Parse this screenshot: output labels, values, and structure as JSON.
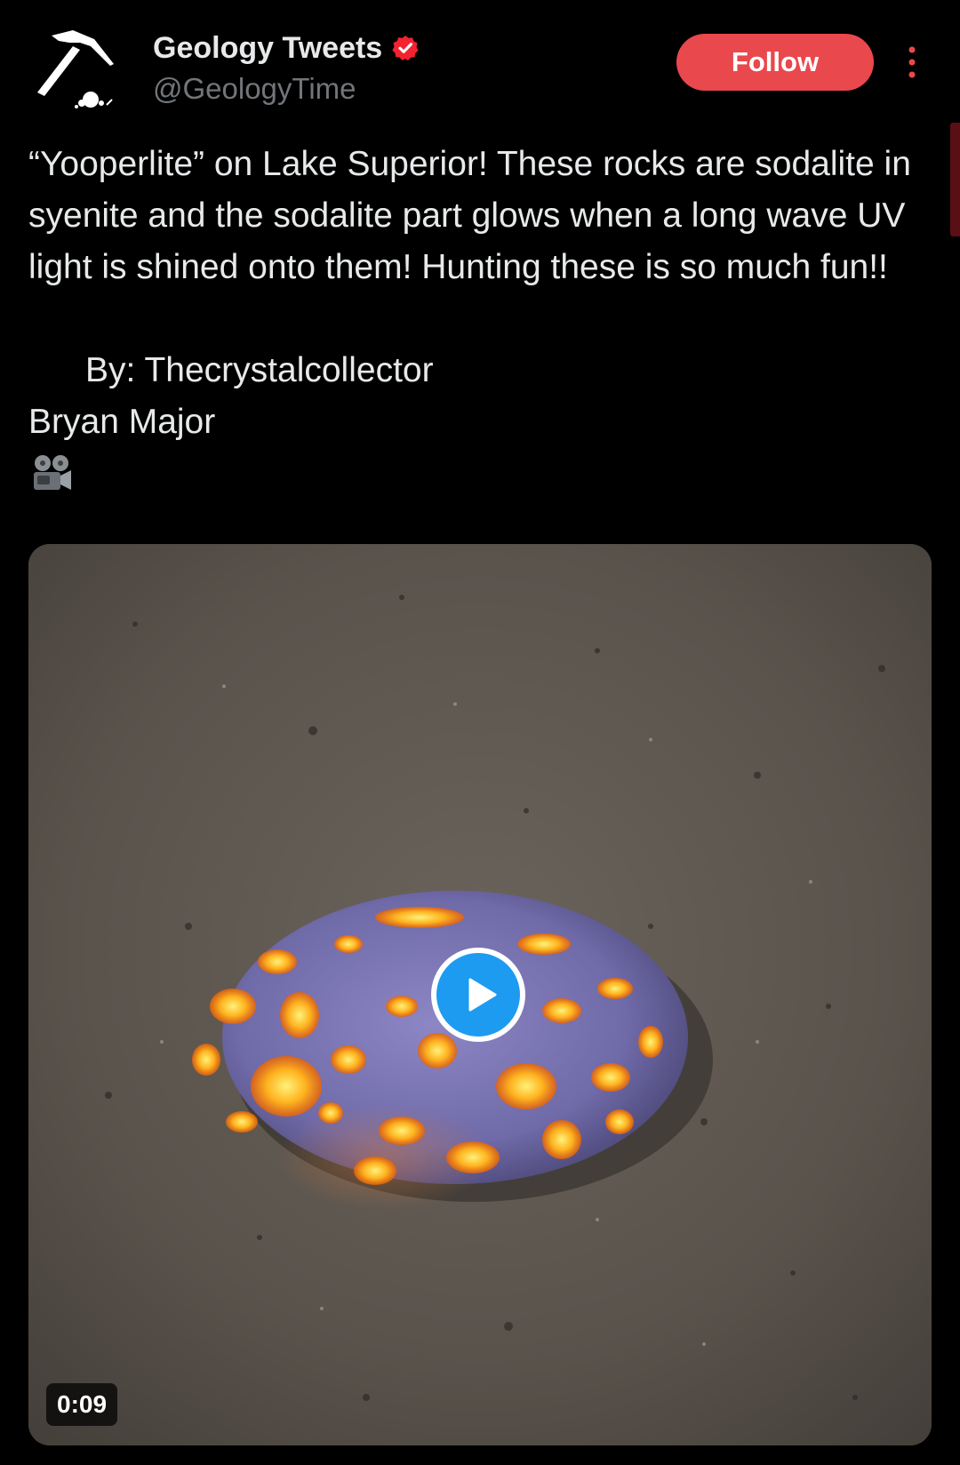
{
  "account": {
    "display_name": "Geology Tweets",
    "handle": "@GeologyTime",
    "verified_icon": "verified-badge-icon",
    "avatar_icon": "rock-hammer-icon"
  },
  "actions": {
    "follow_label": "Follow",
    "more_icon": "more-vertical-icon"
  },
  "tweet": {
    "text_lines": [
      "“Yooperlite” on Lake Superior! These rocks are sodalite in syenite and the sodalite part glows when a long wave UV light is shined onto them! Hunting these is so much fun!!",
      "",
      "By: Thecrystalcollector",
      "Bryan Major"
    ],
    "credit_icon": "film-projector-icon"
  },
  "media": {
    "type": "video",
    "duration": "0:09",
    "play_icon": "play-icon"
  },
  "colors": {
    "background": "#000000",
    "text_primary": "#e7e9ea",
    "text_secondary": "#71767b",
    "follow_button": "#e9484d",
    "verified": "#f4212e",
    "play_button": "#1d9bf0"
  }
}
